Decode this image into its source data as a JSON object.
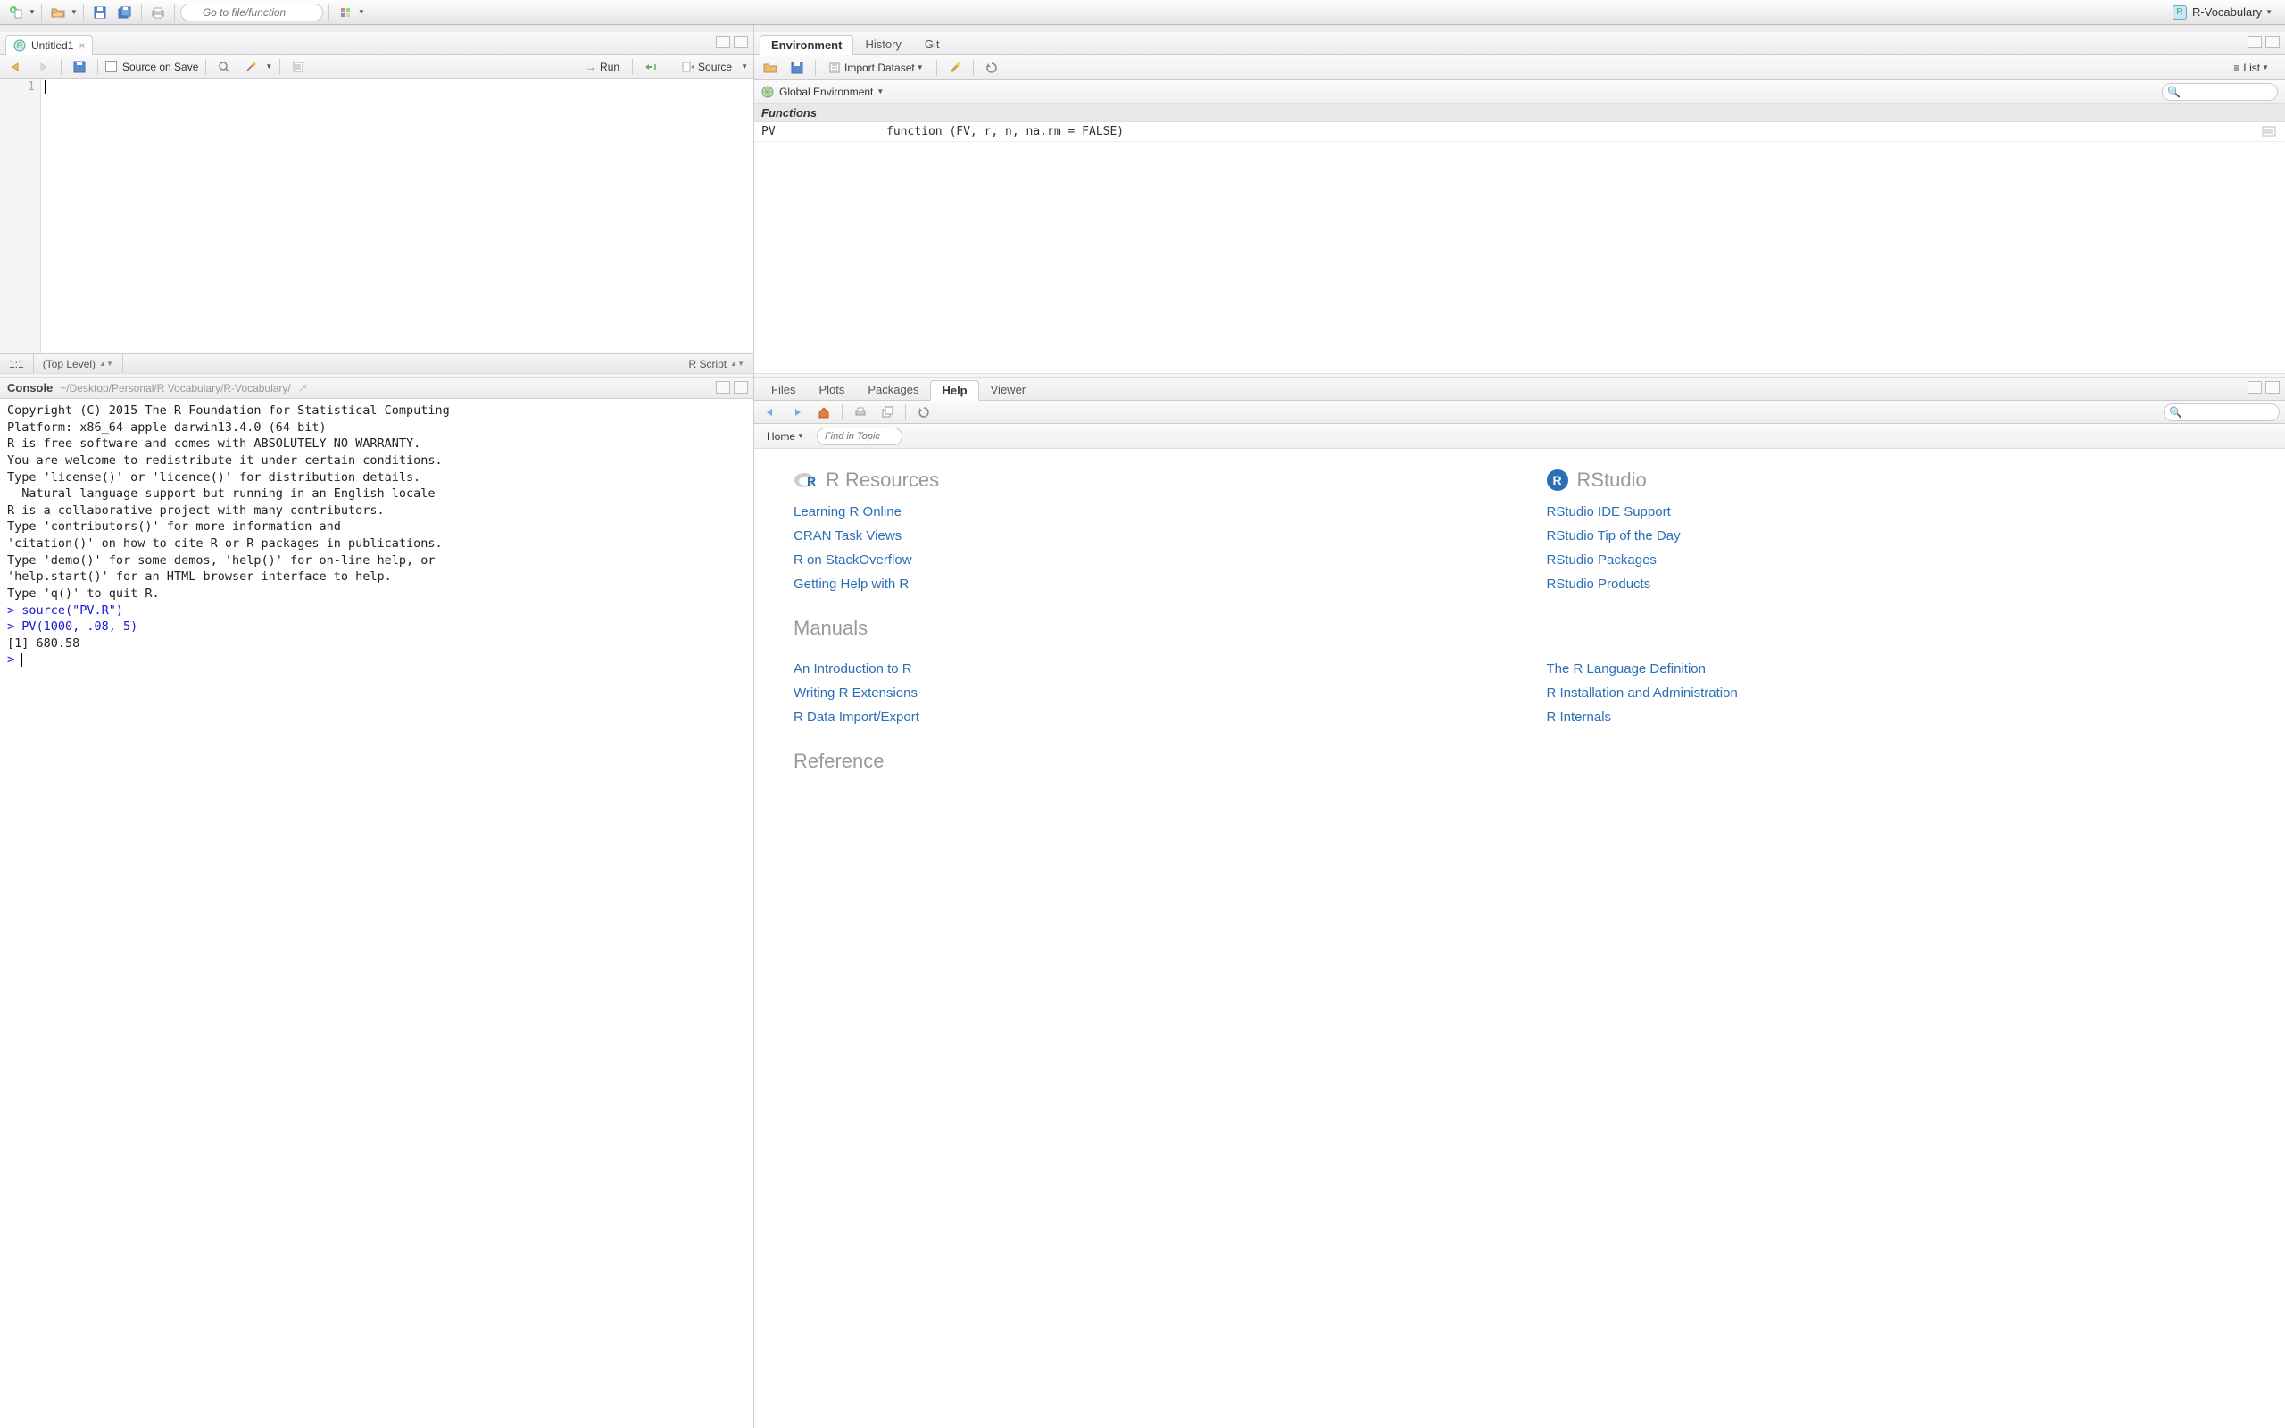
{
  "toolbar": {
    "goto_placeholder": "Go to file/function",
    "project_name": "R-Vocabulary"
  },
  "source": {
    "tab_title": "Untitled1",
    "source_on_save": "Source on Save",
    "run_label": "Run",
    "source_label": "Source",
    "line_number": "1",
    "status_pos": "1:1",
    "status_scope": "(Top Level)",
    "status_type": "R Script"
  },
  "console": {
    "title": "Console",
    "path": "~/Desktop/Personal/R Vocabulary/R-Vocabulary/",
    "lines": [
      {
        "cls": "out",
        "text": "Copyright (C) 2015 The R Foundation for Statistical Computing"
      },
      {
        "cls": "out",
        "text": "Platform: x86_64-apple-darwin13.4.0 (64-bit)"
      },
      {
        "cls": "out",
        "text": ""
      },
      {
        "cls": "out",
        "text": "R is free software and comes with ABSOLUTELY NO WARRANTY."
      },
      {
        "cls": "out",
        "text": "You are welcome to redistribute it under certain conditions."
      },
      {
        "cls": "out",
        "text": "Type 'license()' or 'licence()' for distribution details."
      },
      {
        "cls": "out",
        "text": ""
      },
      {
        "cls": "out",
        "text": "  Natural language support but running in an English locale"
      },
      {
        "cls": "out",
        "text": ""
      },
      {
        "cls": "out",
        "text": "R is a collaborative project with many contributors."
      },
      {
        "cls": "out",
        "text": "Type 'contributors()' for more information and"
      },
      {
        "cls": "out",
        "text": "'citation()' on how to cite R or R packages in publications."
      },
      {
        "cls": "out",
        "text": ""
      },
      {
        "cls": "out",
        "text": "Type 'demo()' for some demos, 'help()' for on-line help, or"
      },
      {
        "cls": "out",
        "text": "'help.start()' for an HTML browser interface to help."
      },
      {
        "cls": "out",
        "text": "Type 'q()' to quit R."
      },
      {
        "cls": "out",
        "text": ""
      },
      {
        "cls": "cmd",
        "text": "> source(\"PV.R\")"
      },
      {
        "cls": "cmd",
        "text": "> PV(1000, .08, 5)"
      },
      {
        "cls": "out",
        "text": "[1] 680.58"
      }
    ],
    "prompt": "> "
  },
  "env": {
    "tabs": [
      "Environment",
      "History",
      "Git"
    ],
    "active_tab": 0,
    "import_label": "Import Dataset",
    "list_label": "List",
    "scope_label": "Global Environment",
    "section": "Functions",
    "rows": [
      {
        "name": "PV",
        "value": "function (FV, r, n, na.rm = FALSE)"
      }
    ]
  },
  "help": {
    "tabs": [
      "Files",
      "Plots",
      "Packages",
      "Help",
      "Viewer"
    ],
    "active_tab": 3,
    "home_label": "Home",
    "topic_placeholder": "Find in Topic",
    "sections": {
      "r_resources": "R Resources",
      "rstudio": "RStudio",
      "manuals": "Manuals",
      "reference": "Reference"
    },
    "links": {
      "rres": [
        "Learning R Online",
        "CRAN Task Views",
        "R on StackOverflow",
        "Getting Help with R"
      ],
      "rstudio": [
        "RStudio IDE Support",
        "RStudio Tip of the Day",
        "RStudio Packages",
        "RStudio Products"
      ],
      "manuals_l": [
        "An Introduction to R",
        "Writing R Extensions",
        "R Data Import/Export"
      ],
      "manuals_r": [
        "The R Language Definition",
        "R Installation and Administration",
        "R Internals"
      ]
    }
  }
}
